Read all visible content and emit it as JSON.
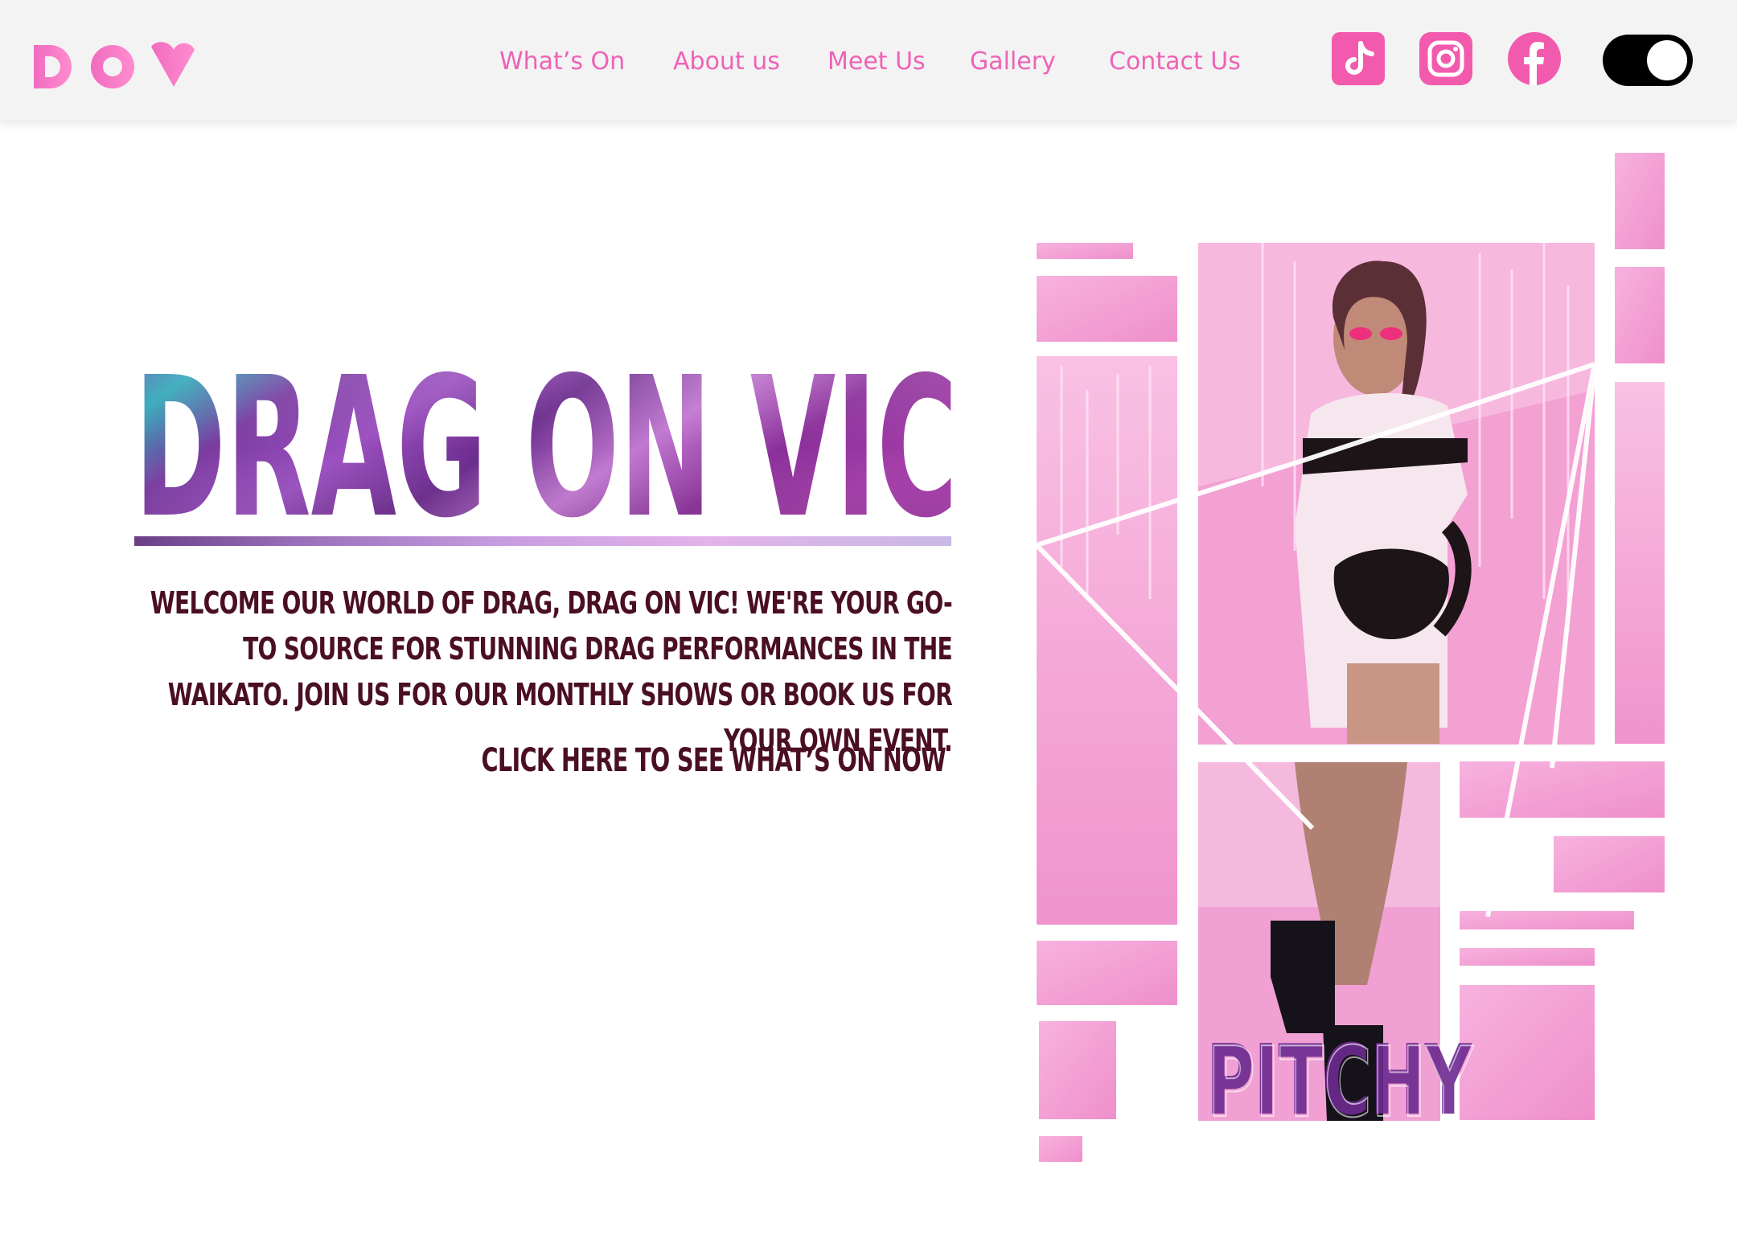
{
  "header": {
    "logo_text": "DOV",
    "nav": [
      {
        "label": "What’s On"
      },
      {
        "label": "About us"
      },
      {
        "label": "Meet Us"
      },
      {
        "label": "Gallery"
      },
      {
        "label": "Contact Us"
      }
    ],
    "social": [
      {
        "icon": "tiktok-icon"
      },
      {
        "icon": "instagram-icon"
      },
      {
        "icon": "facebook-icon"
      }
    ],
    "theme_toggle": {
      "state": "on"
    }
  },
  "hero": {
    "title": "DRAG ON VIC",
    "description": "Welcome our world of drag, Drag On Vic! We're your go-to source for stunning drag performances in the Waikato. Join us for our monthly shows or book us for your own event.",
    "cta": "CLICK HERE TO SEE WHAT’S ON NOW"
  },
  "feature": {
    "performer_name": "PITCHY"
  },
  "colors": {
    "accent_pink": "#ef62b6",
    "header_bg": "#f3f3f3",
    "text_dark": "#4a0f22",
    "tile_pink": "#f3a3d6",
    "title_purple": "#7a3aa0"
  }
}
